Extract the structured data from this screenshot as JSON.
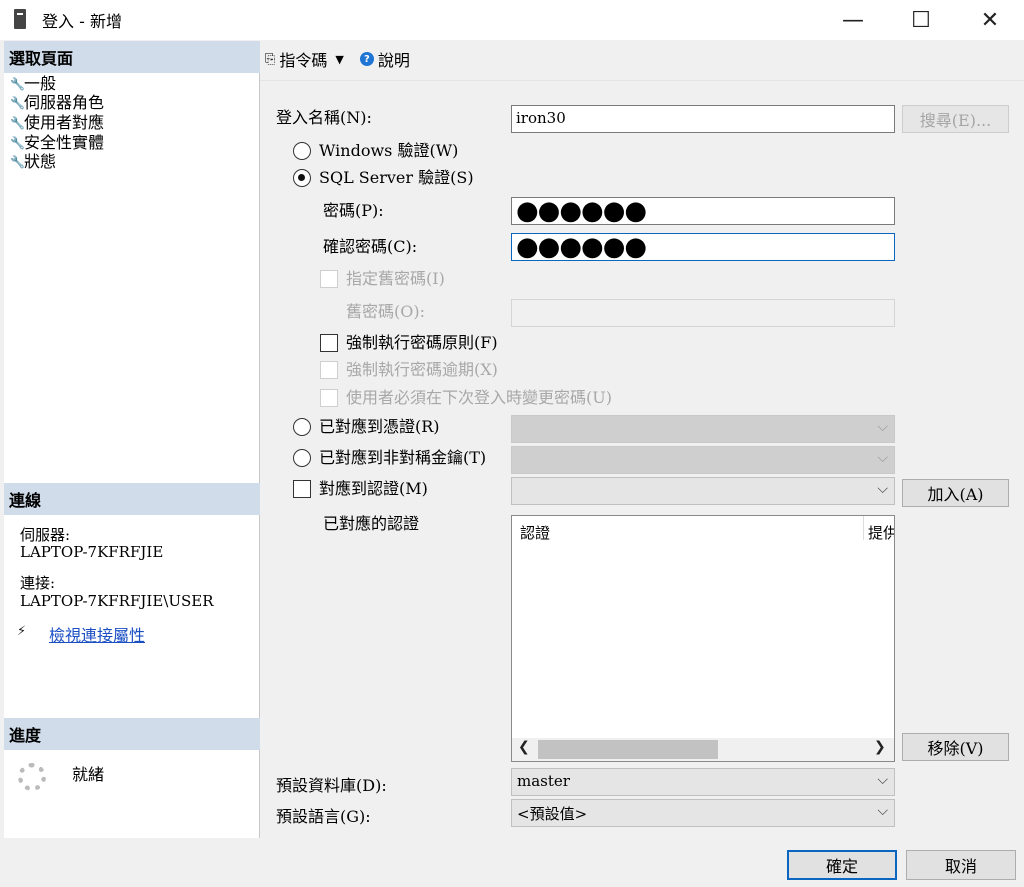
{
  "window": {
    "title": "登入 - 新增",
    "min_glyph": "—",
    "max_glyph": "☐",
    "close_glyph": "✕"
  },
  "left": {
    "select_page_header": "選取頁面",
    "pages": [
      "一般",
      "伺服器角色",
      "使用者對應",
      "安全性實體",
      "狀態"
    ],
    "connection_header": "連線",
    "server_label": "伺服器:",
    "server_value": "LAPTOP-7KFRFJIE",
    "connect_label": "連接:",
    "connect_value": "LAPTOP-7KFRFJIE\\USER",
    "view_props_link": "檢視連接屬性",
    "progress_header": "進度",
    "progress_status": "就緒"
  },
  "toolbar": {
    "script_label": "指令碼",
    "help_label": "說明"
  },
  "form": {
    "login_name_label": "登入名稱(N):",
    "login_name_value": "iron30",
    "search_button": "搜尋(E)...",
    "windows_auth": "Windows 驗證(W)",
    "sql_auth": "SQL Server 驗證(S)",
    "password_label": "密碼(P):",
    "password_value": "●●●●●●",
    "confirm_label": "確認密碼(C):",
    "confirm_value": "●●●●●●",
    "specify_old_pw": "指定舊密碼(I)",
    "old_pw_label": "舊密碼(O):",
    "enforce_policy": "強制執行密碼原則(F)",
    "enforce_expiration": "強制執行密碼逾期(X)",
    "must_change": "使用者必須在下次登入時變更密碼(U)",
    "mapped_cert": "已對應到憑證(R)",
    "mapped_asym_key": "已對應到非對稱金鑰(T)",
    "map_to_credential": "對應到認證(M)",
    "add_button": "加入(A)",
    "mapped_credentials_label": "已對應的認證",
    "list_col_credential": "認證",
    "list_col_provider": "提供",
    "remove_button": "移除(V)",
    "default_db_label": "預設資料庫(D):",
    "default_db_value": "master",
    "default_lang_label": "預設語言(G):",
    "default_lang_value": "<預設值>"
  },
  "footer": {
    "ok_button": "確定",
    "cancel_button": "取消"
  },
  "state": {
    "auth_mode": "sql",
    "enforce_policy_checked": false,
    "map_to_credential_checked": false
  }
}
